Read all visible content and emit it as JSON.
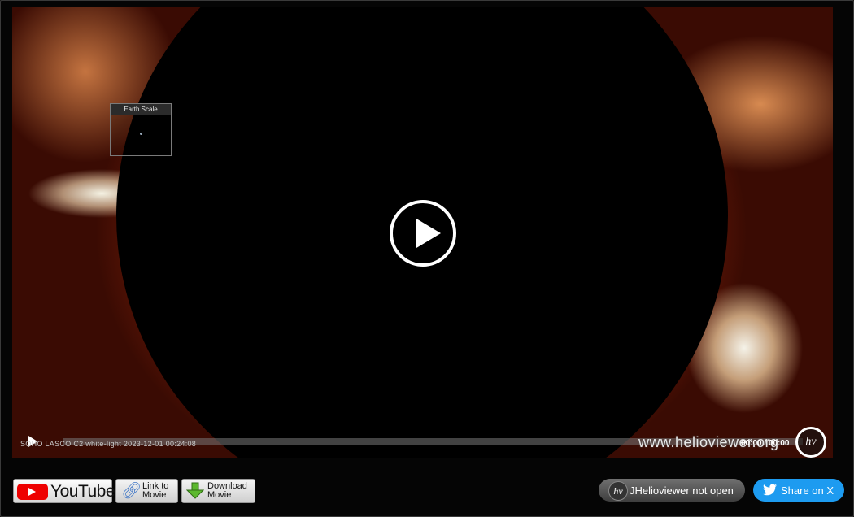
{
  "player": {
    "earth_scale_label": "Earth Scale",
    "caption": "SOHO LASCO C2 white-light  2023-12-01 00:24:08",
    "watermark": "www.helioviewer.org",
    "time_display": "00:00 / 00:00",
    "logo_text": "hv",
    "progress_fraction": 0
  },
  "buttons": {
    "youtube_label": "YouTube",
    "link_line1": "Link to",
    "link_line2": "Movie",
    "download_line1": "Download",
    "download_line2": "Movie",
    "jhelioviewer_status": "JHelioviewer not open",
    "jhelioviewer_logo": "hv",
    "share_x": "Share on X"
  },
  "colors": {
    "youtube_red": "#ee0000",
    "share_blue": "#1d9bf0",
    "corona_orange": "#c8440c"
  },
  "icons": [
    "play-icon",
    "youtube-icon",
    "link-icon",
    "download-icon",
    "helioviewer-logo-icon",
    "twitter-bird-icon"
  ]
}
